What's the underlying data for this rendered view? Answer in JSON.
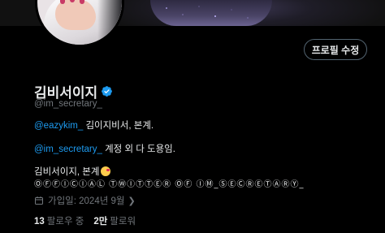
{
  "profile": {
    "display_name": "김비서이지",
    "handle": "@im_secretary_",
    "edit_button_label": "프로필 수정",
    "bio": {
      "line1_mention": "@eazykim_",
      "line1_text": " 김이지비서, 본계.",
      "line2_mention": "@im_secretary_",
      "line2_text": " 계정 외 다 도용임.",
      "line3_text": "김비서이지, 본계",
      "line4_text": "ⓄⒻⒻⒾⒸⒾⒶⓁ ⓉⓌⒾⓉⓉⒺⓇ ⓄⒻ ⒾⓂ_ⓈⒺⒸⓇⒺⓉⒶⓇⓎ_"
    },
    "joined": "가입일: 2024년 9월",
    "following_count": "13",
    "following_label": "팔로우 중",
    "followers_count": "2만",
    "followers_label": "팔로워"
  },
  "icons": {
    "verified": "verified-badge-icon",
    "calendar": "calendar-icon",
    "chevron": "chevron-right-icon",
    "emoji": "kissing-heart-emoji-icon"
  },
  "colors": {
    "background": "#000000",
    "text_primary": "#e7e9ea",
    "text_secondary": "#71767b",
    "link": "#1d9bf0",
    "button_border": "#536471"
  }
}
